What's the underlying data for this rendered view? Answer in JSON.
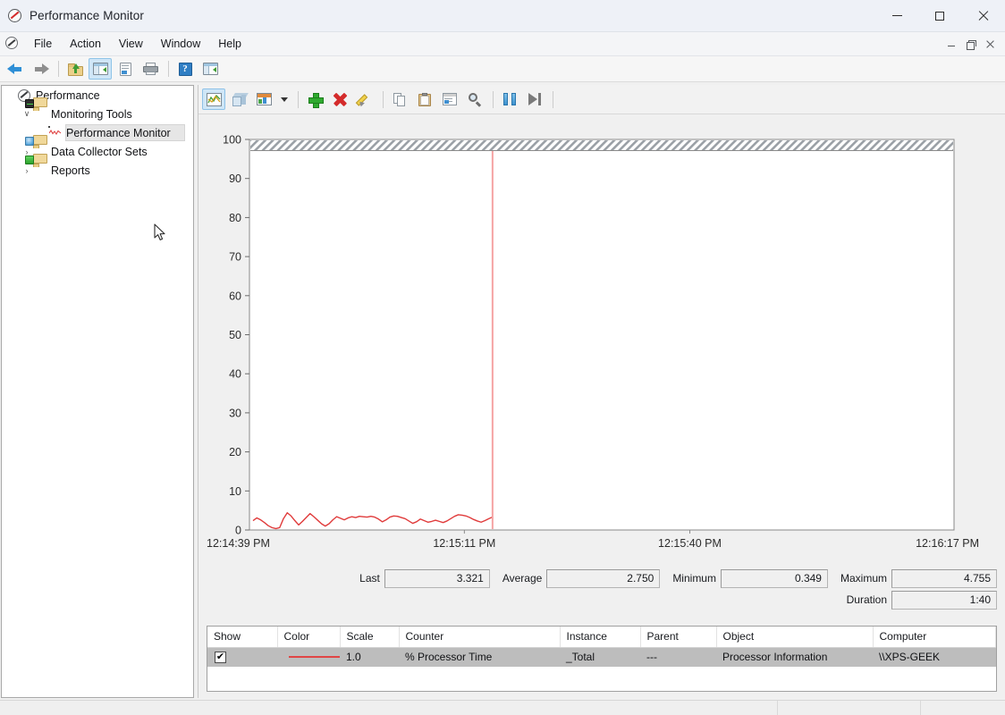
{
  "window": {
    "title": "Performance Monitor",
    "icon": "performance-monitor-icon",
    "minimize": "–",
    "maximize": "□",
    "close": "✕"
  },
  "menu": {
    "items": [
      {
        "label": "File"
      },
      {
        "label": "Action"
      },
      {
        "label": "View"
      },
      {
        "label": "Window"
      },
      {
        "label": "Help"
      }
    ],
    "mdi": {
      "minimize": "minimize-icon",
      "restore": "restore-icon",
      "close": "close-icon"
    }
  },
  "main_toolbar": {
    "buttons": [
      {
        "name": "back-button",
        "icon": "back-arrow-icon",
        "enabled": true
      },
      {
        "name": "forward-button",
        "icon": "forward-arrow-icon",
        "enabled": false
      },
      {
        "name": "up-one-level-button",
        "icon": "folder-up-icon"
      },
      {
        "name": "show-console-tree-button",
        "icon": "console-tree-icon",
        "active": true
      },
      {
        "name": "properties-button",
        "icon": "properties-document-icon"
      },
      {
        "name": "print-button",
        "icon": "printer-icon"
      },
      {
        "name": "help-button",
        "icon": "help-question-icon"
      },
      {
        "name": "new-window-button",
        "icon": "new-window-icon"
      }
    ]
  },
  "sidebar": {
    "items": [
      {
        "label": "Performance",
        "icon": "performance-root-icon",
        "indent": 0,
        "twisty": "",
        "selected": false
      },
      {
        "label": "Monitoring Tools",
        "icon": "folder-monitor-icon",
        "indent": 1,
        "twisty": "∨",
        "selected": false
      },
      {
        "label": "Performance Monitor",
        "icon": "perfmon-chart-icon",
        "indent": 2,
        "twisty": "",
        "selected": true
      },
      {
        "label": "Data Collector Sets",
        "icon": "folder-disc-icon",
        "indent": 1,
        "twisty": "›",
        "selected": false
      },
      {
        "label": "Reports",
        "icon": "folder-green-icon",
        "indent": 1,
        "twisty": "›",
        "selected": false
      }
    ]
  },
  "graph_toolbar": {
    "buttons": [
      {
        "name": "view-line-graph-button",
        "icon": "line-graph-icon",
        "active": true
      },
      {
        "name": "view-histogram-button",
        "icon": "cube-3d-icon"
      },
      {
        "name": "view-report-button",
        "icon": "report-image-icon"
      },
      {
        "name": "change-graph-type-dropdown",
        "icon": "chevron-down-icon"
      },
      {
        "name": "add-counter-button",
        "icon": "green-plus-icon"
      },
      {
        "name": "delete-counter-button",
        "icon": "red-x-icon"
      },
      {
        "name": "highlight-button",
        "icon": "pencil-highlight-icon"
      },
      {
        "name": "copy-properties-button",
        "icon": "copy-pages-icon"
      },
      {
        "name": "paste-counter-list-button",
        "icon": "clipboard-icon"
      },
      {
        "name": "properties-button",
        "icon": "properties-window-icon"
      },
      {
        "name": "zoom-to-button",
        "icon": "magnifier-icon"
      },
      {
        "name": "freeze-display-button",
        "icon": "pause-icon"
      },
      {
        "name": "update-data-button",
        "icon": "step-forward-icon"
      }
    ]
  },
  "chart_data": {
    "type": "line",
    "title": "",
    "xlabel": "",
    "ylabel": "",
    "ylim": [
      0,
      100
    ],
    "yticks": [
      0,
      10,
      20,
      30,
      40,
      50,
      60,
      70,
      80,
      90,
      100
    ],
    "grid": false,
    "legend_position": "below-table",
    "x_tick_labels": [
      "12:14:39 PM",
      "12:15:11 PM",
      "12:15:40 PM",
      "12:16:17 PM"
    ],
    "scan_line_position_pct": 34.5,
    "series": [
      {
        "name": "% Processor Time",
        "color": "#e03b3b",
        "scale": "1.0",
        "values": [
          2.4,
          3.1,
          2.6,
          1.9,
          1.1,
          0.6,
          0.349,
          0.6,
          2.9,
          4.4,
          3.6,
          2.4,
          1.3,
          2.2,
          3.2,
          4.2,
          3.4,
          2.5,
          1.6,
          1.0,
          1.6,
          2.6,
          3.4,
          3.0,
          2.6,
          3.1,
          3.4,
          3.2,
          3.5,
          3.4,
          3.3,
          3.5,
          3.3,
          2.8,
          2.1,
          2.6,
          3.3,
          3.6,
          3.5,
          3.2,
          2.9,
          2.3,
          1.7,
          2.1,
          2.8,
          2.4,
          2.0,
          2.2,
          2.5,
          2.2,
          1.9,
          2.3,
          2.9,
          3.5,
          3.9,
          3.8,
          3.6,
          3.2,
          2.7,
          2.3,
          2.0,
          2.4,
          2.9,
          3.321
        ]
      }
    ]
  },
  "statistics": {
    "last": {
      "label": "Last",
      "value": "3.321"
    },
    "average": {
      "label": "Average",
      "value": "2.750"
    },
    "minimum": {
      "label": "Minimum",
      "value": "0.349"
    },
    "maximum": {
      "label": "Maximum",
      "value": "4.755"
    },
    "duration": {
      "label": "Duration",
      "value": "1:40"
    }
  },
  "legend_table": {
    "columns": [
      "Show",
      "Color",
      "Scale",
      "Counter",
      "Instance",
      "Parent",
      "Object",
      "Computer"
    ],
    "rows": [
      {
        "show": "✔",
        "color": "#e04545",
        "scale": "1.0",
        "counter": "% Processor Time",
        "instance": "_Total",
        "parent": "---",
        "object": "Processor Information",
        "computer": "\\\\XPS-GEEK",
        "selected": true
      }
    ]
  },
  "statusbar": {
    "text": ""
  }
}
